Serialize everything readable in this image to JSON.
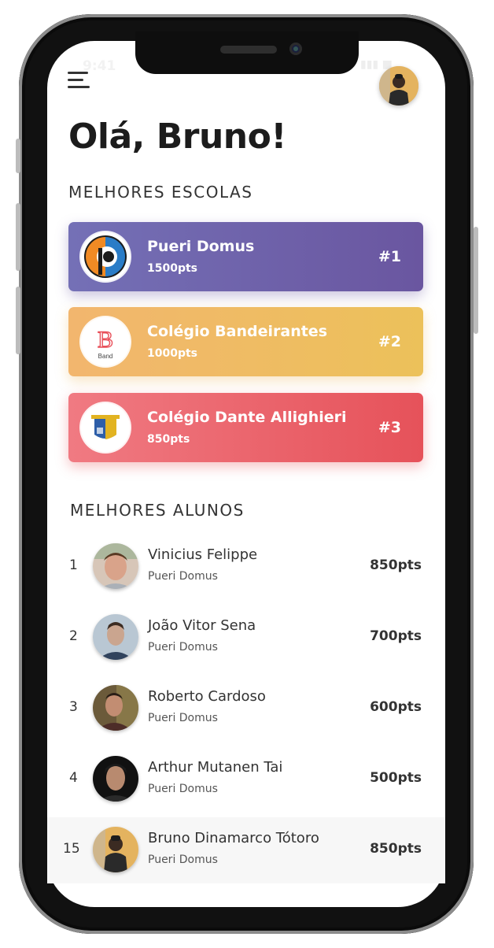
{
  "status": {
    "time": "9:41",
    "icons": "▮▮▮ ■"
  },
  "header": {
    "greeting": "Olá, Bruno!",
    "menu_icon": "hamburger-menu-icon"
  },
  "schools": {
    "title": "MELHORES ESCOLAS",
    "items": [
      {
        "name": "Pueri Domus",
        "points": "1500pts",
        "rank": "#1",
        "color_start": "#7470b6",
        "color_end": "#6a56a0"
      },
      {
        "name": "Colégio Bandeirantes",
        "points": "1000pts",
        "rank": "#2",
        "color_start": "#f2b66e",
        "color_end": "#ecc15a",
        "logo_letter": "B",
        "logo_text": "Band"
      },
      {
        "name": "Colégio Dante Allighieri",
        "points": "850pts",
        "rank": "#3",
        "color_start": "#f07a82",
        "color_end": "#e6525a"
      }
    ]
  },
  "students": {
    "title": "MELHORES ALUNOS",
    "items": [
      {
        "rank": "1",
        "name": "Vinicius Felippe",
        "school": "Pueri Domus",
        "points": "850pts"
      },
      {
        "rank": "2",
        "name": "João Vitor Sena",
        "school": "Pueri Domus",
        "points": "700pts"
      },
      {
        "rank": "3",
        "name": "Roberto Cardoso",
        "school": "Pueri Domus",
        "points": "600pts"
      },
      {
        "rank": "4",
        "name": "Arthur Mutanen Tai",
        "school": "Pueri Domus",
        "points": "500pts"
      },
      {
        "rank": "15",
        "name": "Bruno Dinamarco Tótoro",
        "school": "Pueri Domus",
        "points": "850pts"
      }
    ]
  }
}
